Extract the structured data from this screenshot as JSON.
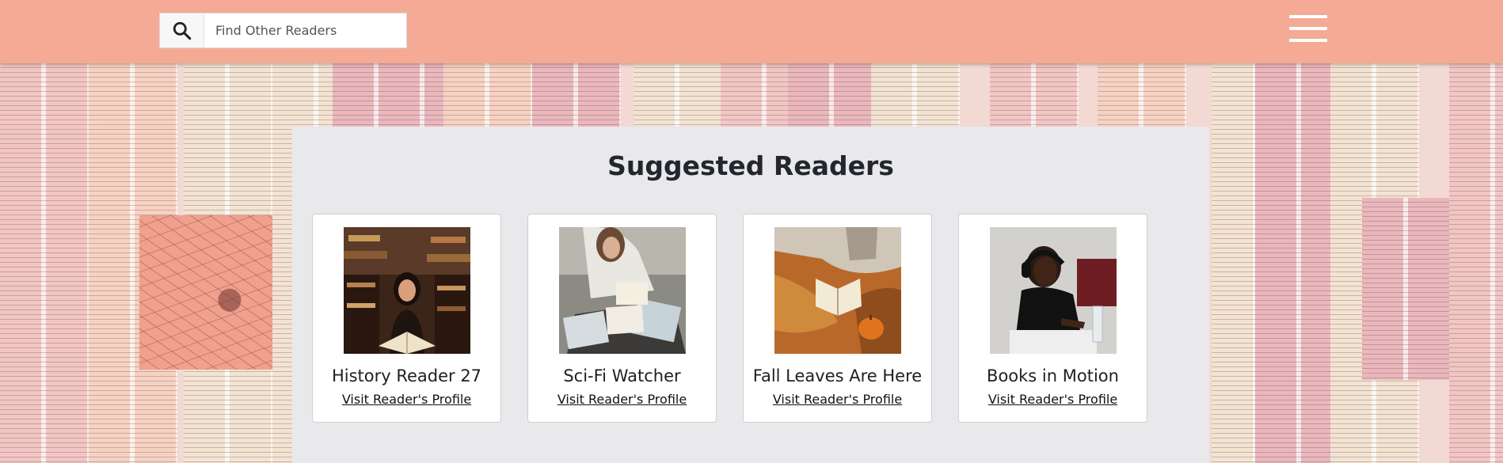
{
  "search": {
    "placeholder": "Find Other Readers",
    "icon": "search-icon"
  },
  "header": {
    "menu_icon": "hamburger-menu-icon",
    "color": "#f4aa95"
  },
  "panel": {
    "title": "Suggested Readers",
    "readers": [
      {
        "name": "History Reader 27",
        "link": "Visit Reader's Profile"
      },
      {
        "name": "Sci-Fi Watcher",
        "link": "Visit Reader's Profile"
      },
      {
        "name": "Fall Leaves Are Here",
        "link": "Visit Reader's Profile"
      },
      {
        "name": "Books in Motion",
        "link": "Visit Reader's Profile"
      }
    ]
  }
}
